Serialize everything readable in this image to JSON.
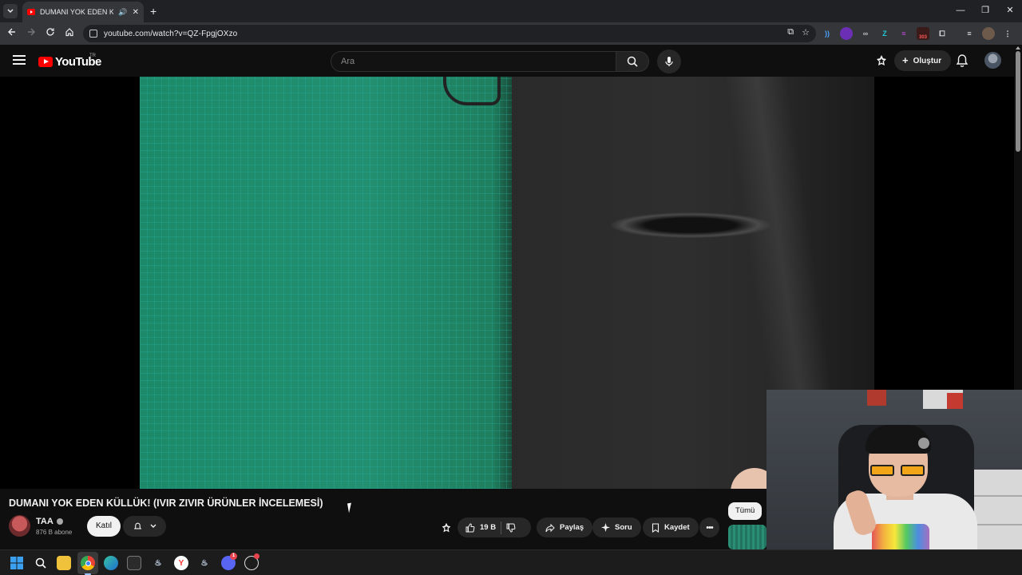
{
  "browser": {
    "tab": {
      "title": "DUMANI YOK EDEN KÜLLÜ",
      "close": "✕",
      "sound": "🔊"
    },
    "new_tab": "+",
    "url": "youtube.com/watch?v=QZ-FpgjOXzo",
    "extension_badge": "303",
    "window_controls": [
      "—",
      "❐",
      "✕"
    ]
  },
  "youtube": {
    "logo_text": "YouTube",
    "region": "TR",
    "search_placeholder": "Ara",
    "create_label": "Oluştur"
  },
  "video": {
    "title": "DUMANI YOK EDEN KÜLLÜK! (IVIR ZIVIR ÜRÜNLER İNCELEMESİ)",
    "channel": {
      "name": "TAA",
      "subscribers": "876 B abone",
      "join_label": "Katıl"
    },
    "actions": {
      "likes": "19 B",
      "share": "Paylaş",
      "ask": "Soru",
      "save": "Kaydet",
      "more": "•••"
    },
    "filter_chip": "Tümü"
  },
  "taskbar": {
    "apps": [
      "windows-start",
      "search",
      "file-explorer",
      "chrome",
      "edge",
      "store",
      "steam",
      "yandex",
      "steam-2",
      "discord",
      "chatgpt"
    ],
    "discord_badge": "1"
  },
  "colors": {
    "youtube_red": "#ff0000",
    "background": "#0f0f0f",
    "pill": "#272727"
  }
}
